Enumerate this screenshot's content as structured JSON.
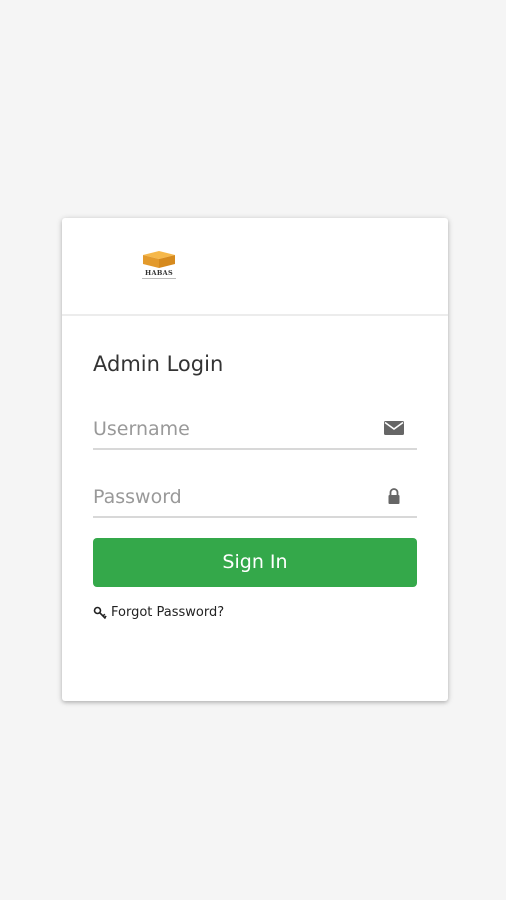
{
  "logo": {
    "text": "HABAS"
  },
  "login": {
    "title": "Admin Login",
    "username_placeholder": "Username",
    "password_placeholder": "Password",
    "signin_label": "Sign In",
    "forgot_label": "Forgot Password?"
  },
  "icons": {
    "username": "envelope-icon",
    "password": "lock-icon",
    "forgot": "key-icon"
  },
  "colors": {
    "primary": "#34a84a",
    "background": "#f5f5f5",
    "logo_accent": "#f0a630"
  }
}
